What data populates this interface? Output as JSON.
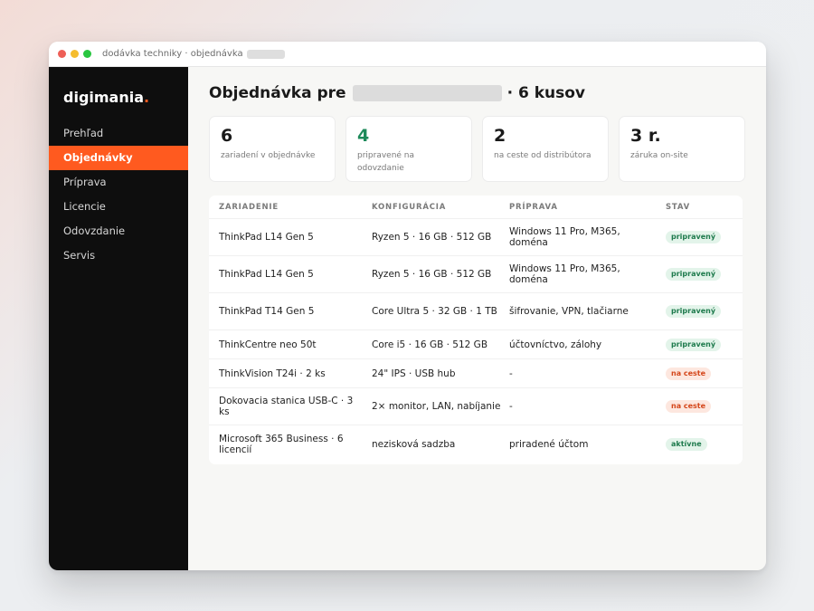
{
  "window": {
    "title": "dodávka techniky · objednávka"
  },
  "sidebar": {
    "logo": "digimania",
    "logo_dot": ".",
    "items": [
      {
        "label": "Prehľad"
      },
      {
        "label": "Objednávky"
      },
      {
        "label": "Príprava"
      },
      {
        "label": "Licencie"
      },
      {
        "label": "Odovzdanie"
      },
      {
        "label": "Servis"
      }
    ]
  },
  "main": {
    "heading_prefix": "Objednávka pre",
    "heading_suffix": "· 6 kusov",
    "stats": [
      {
        "value": "6",
        "label": "zariadení v objednávke"
      },
      {
        "value": "4",
        "label": "pripravené na odovzdanie"
      },
      {
        "value": "2",
        "label": "na ceste od distribútora"
      },
      {
        "value": "3 r.",
        "label": "záruka on-site"
      }
    ],
    "table": {
      "headers": [
        "ZARIADENIE",
        "KONFIGURÁCIA",
        "PRÍPRAVA",
        "STAV"
      ],
      "rows": [
        {
          "device": "ThinkPad L14 Gen 5",
          "config": "Ryzen 5 · 16 GB · 512 GB",
          "prep": "Windows 11 Pro, M365, doména",
          "status": "pripravený"
        },
        {
          "device": "ThinkPad L14 Gen 5",
          "config": "Ryzen 5 · 16 GB · 512 GB",
          "prep": "Windows 11 Pro, M365, doména",
          "status": "pripravený"
        },
        {
          "device": "ThinkPad T14 Gen 5",
          "config": "Core Ultra 5 · 32 GB · 1 TB",
          "prep": "šifrovanie, VPN, tlačiarne",
          "status": "pripravený"
        },
        {
          "device": "ThinkCentre neo 50t",
          "config": "Core i5 · 16 GB · 512 GB",
          "prep": "účtovníctvo, zálohy",
          "status": "pripravený"
        },
        {
          "device": "ThinkVision T24i · 2 ks",
          "config": "24\" IPS · USB hub",
          "prep": "-",
          "status": "na ceste"
        },
        {
          "device": "Dokovacia stanica USB-C · 3 ks",
          "config": "2× monitor, LAN, nabíjanie",
          "prep": "-",
          "status": "na ceste"
        },
        {
          "device": "Microsoft 365 Business · 6 licencií",
          "config": "nezisková sadzba",
          "prep": "priradené účtom",
          "status": "aktívne"
        }
      ]
    }
  },
  "colors": {
    "accent": "#ff5a1f",
    "sidebar_bg": "#0e0e0e",
    "ready_green": "#1d7a4c",
    "transit_red": "#d4461a"
  }
}
